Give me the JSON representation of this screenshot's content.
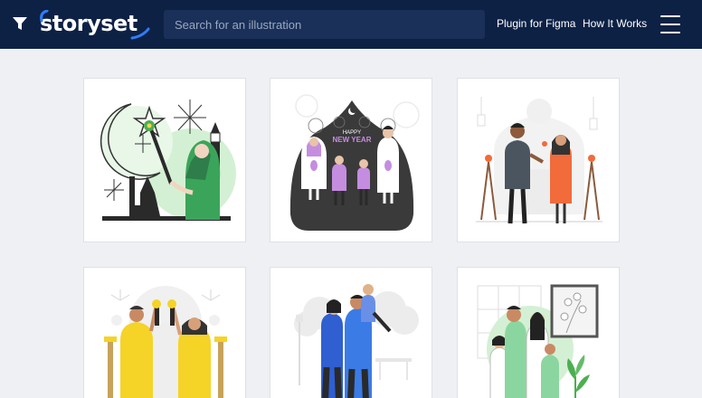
{
  "brand": {
    "name": "storyset"
  },
  "search": {
    "placeholder": "Search for an illustration"
  },
  "nav": {
    "links": [
      {
        "label": "Plugin for Figma"
      },
      {
        "label": "How It Works"
      }
    ]
  },
  "icons": {
    "filter": "filter-icon",
    "menu": "hamburger-menu-icon"
  },
  "gallery": {
    "cards": [
      {
        "illustration": "ramadan-woman-lantern"
      },
      {
        "illustration": "happy-new-year-family"
      },
      {
        "illustration": "couple-greeting-mosque"
      },
      {
        "illustration": "friends-carrying-torches"
      },
      {
        "illustration": "family-hugging-park"
      },
      {
        "illustration": "family-portrait-window"
      }
    ],
    "card1_banner": {
      "line1": "HAPPY",
      "line2": "NEW YEAR"
    }
  },
  "colors": {
    "navbar": "#0d2145",
    "search_bg": "#1a3058",
    "accent_blue": "#2f7cf6",
    "green": "#4caf50",
    "yellow": "#f5d327",
    "purple": "#c58de0",
    "orange": "#f26b3a",
    "dark": "#2e2e2e"
  }
}
